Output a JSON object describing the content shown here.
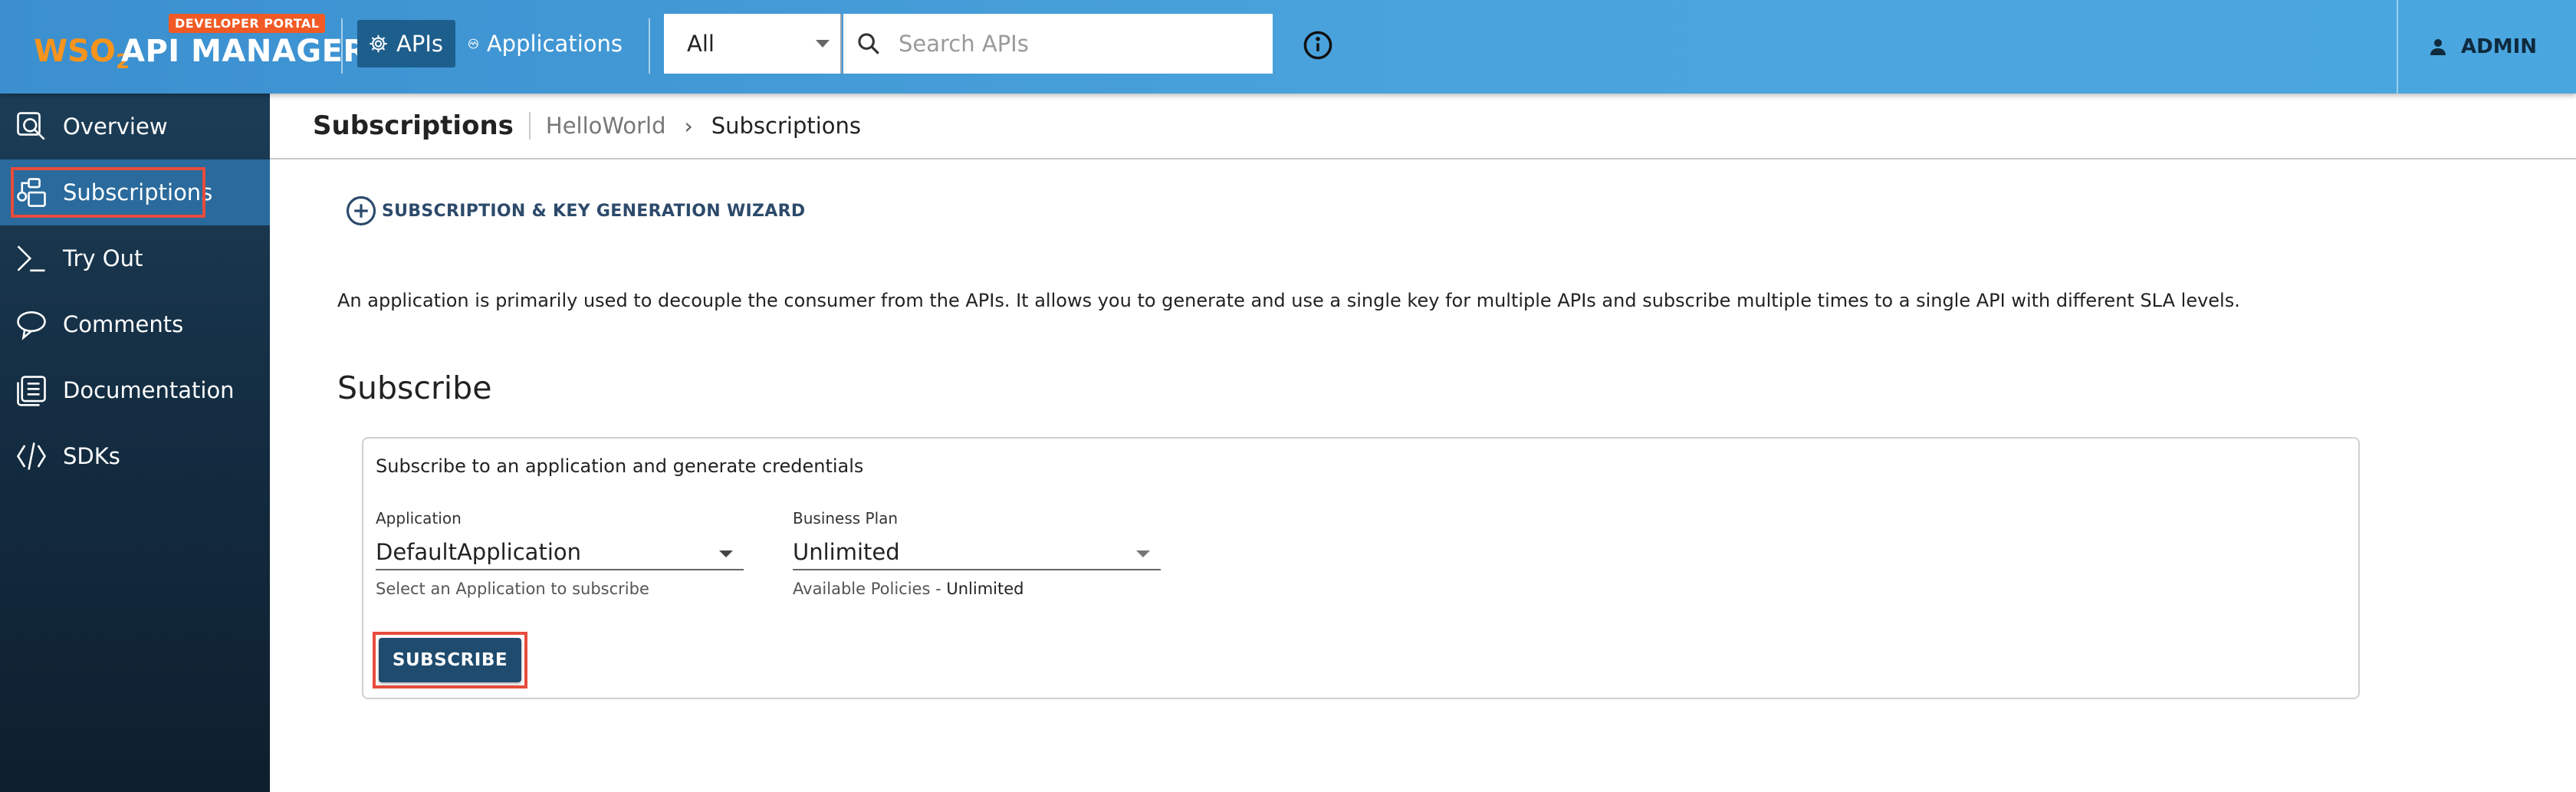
{
  "header": {
    "portal_badge": "DEVELOPER PORTAL",
    "logo_brand": "WSO",
    "logo_sub": "2",
    "product_name": "API MANAGER",
    "nav": [
      {
        "label": "APIs",
        "icon": "gear-icon",
        "active": true
      },
      {
        "label": "Applications",
        "icon": "applications-icon",
        "active": false
      }
    ],
    "search_scope": "All",
    "search_placeholder": "Search APIs",
    "user": "ADMIN"
  },
  "sidebar": {
    "items": [
      {
        "label": "Overview",
        "icon": "overview-icon"
      },
      {
        "label": "Subscriptions",
        "icon": "subscriptions-icon",
        "active": true
      },
      {
        "label": "Try Out",
        "icon": "terminal-icon"
      },
      {
        "label": "Comments",
        "icon": "comments-icon"
      },
      {
        "label": "Documentation",
        "icon": "documentation-icon"
      },
      {
        "label": "SDKs",
        "icon": "code-icon"
      }
    ]
  },
  "breadcrumb": {
    "title": "Subscriptions",
    "api": "HelloWorld",
    "current": "Subscriptions"
  },
  "wizard_label": "SUBSCRIPTION & KEY GENERATION WIZARD",
  "description": "An application is primarily used to decouple the consumer from the APIs. It allows you to generate and use a single key for multiple APIs and subscribe multiple times to a single API with different SLA levels.",
  "subscribe": {
    "heading": "Subscribe",
    "card_title": "Subscribe to an application and generate credentials",
    "application": {
      "label": "Application",
      "value": "DefaultApplication",
      "helper": "Select an Application to subscribe"
    },
    "business_plan": {
      "label": "Business Plan",
      "value": "Unlimited",
      "helper_prefix": "Available Policies - ",
      "helper_value": "Unlimited"
    },
    "button_label": "SUBSCRIBE"
  },
  "colors": {
    "topbar": "#4aa3dc",
    "sidebar": "#142d42",
    "active_item": "#2a6a9c",
    "highlight": "#e74c3c",
    "button": "#1e4b6e",
    "badge": "#f15a24"
  }
}
